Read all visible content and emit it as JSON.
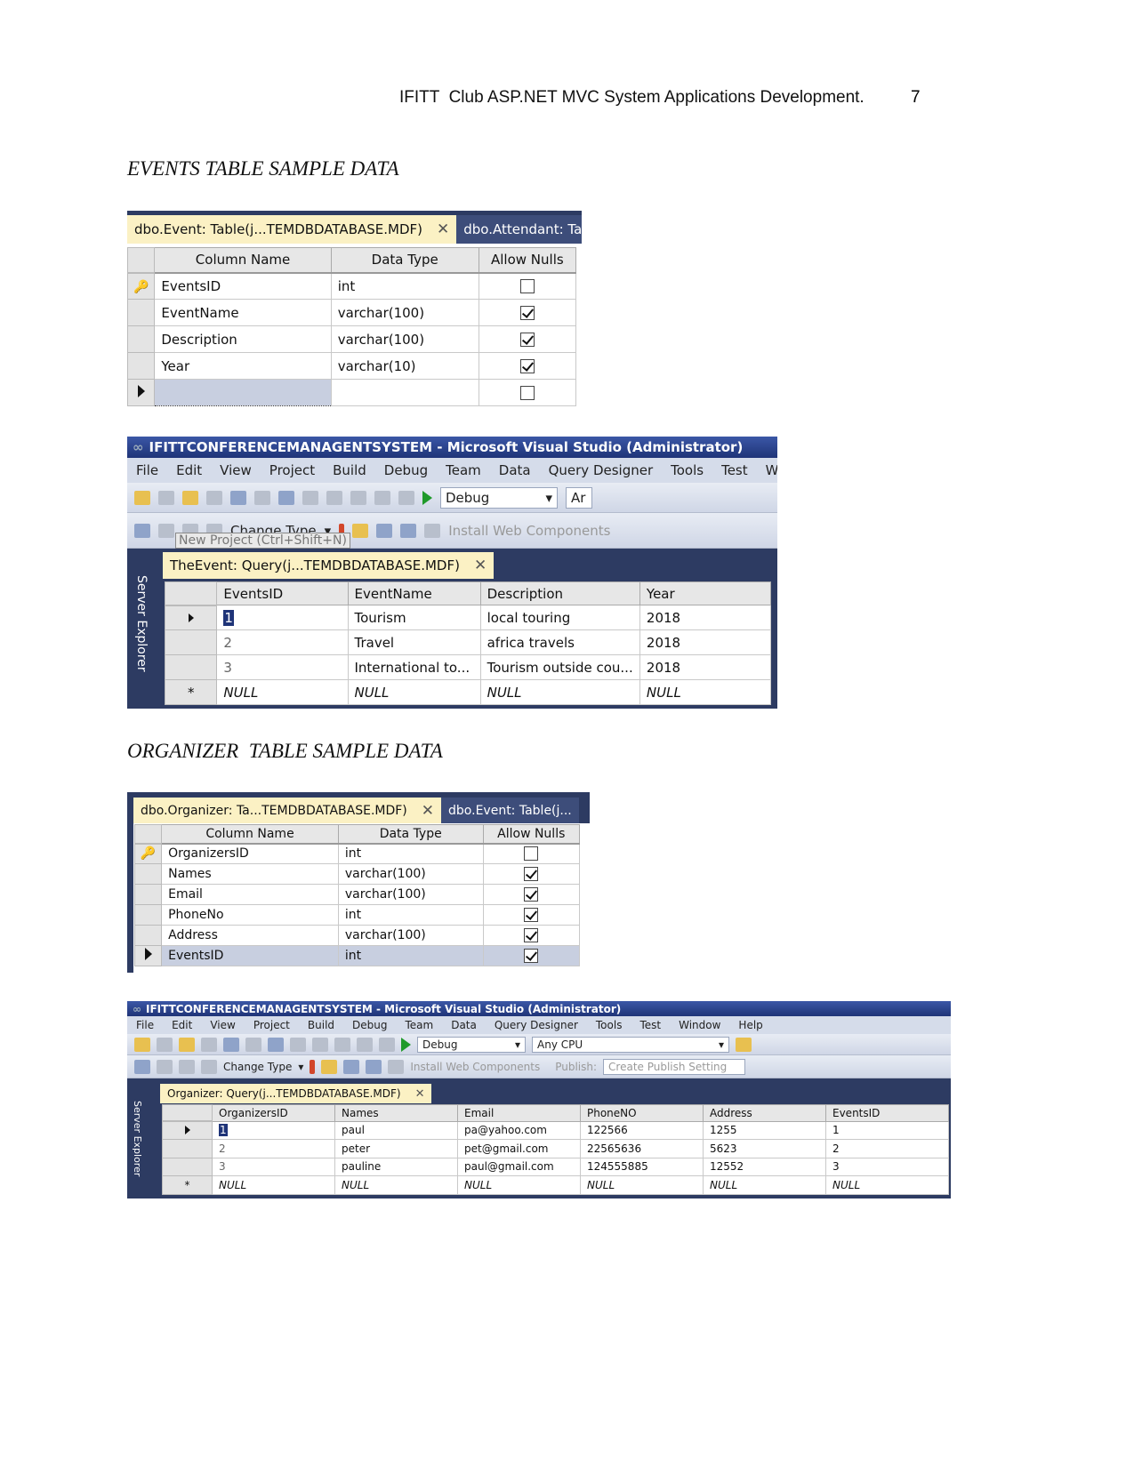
{
  "header": {
    "title": "IFITT  Club ASP.NET MVC System Applications Development.",
    "page_number": "7"
  },
  "sections": [
    {
      "heading": "EVENTS TABLE SAMPLE DATA"
    },
    {
      "heading": "ORGANIZER  TABLE SAMPLE DATA"
    }
  ],
  "event_design": {
    "tabs": [
      "dbo.Event: Table(j...TEMDBDATABASE.MDF)",
      "dbo.Attendant: Ta..."
    ],
    "columns": [
      "Column Name",
      "Data Type",
      "Allow Nulls"
    ],
    "rows": [
      {
        "name": "EventsID",
        "type": "int",
        "nulls": false,
        "key": true
      },
      {
        "name": "EventName",
        "type": "varchar(100)",
        "nulls": true
      },
      {
        "name": "Description",
        "type": "varchar(100)",
        "nulls": true
      },
      {
        "name": "Year",
        "type": "varchar(10)",
        "nulls": true
      },
      {
        "name": "",
        "type": "",
        "nulls": false,
        "current": true
      }
    ]
  },
  "vs1": {
    "title": "IFITTCONFERENCEMANAGENTSYSTEM - Microsoft Visual Studio (Administrator)",
    "menu": [
      "File",
      "Edit",
      "View",
      "Project",
      "Build",
      "Debug",
      "Team",
      "Data",
      "Query Designer",
      "Tools",
      "Test",
      "Win"
    ],
    "config": "Debug",
    "platform": "Ar",
    "change_type": "Change Type",
    "install": "Install Web Components",
    "tooltip": "New Project (Ctrl+Shift+N)",
    "sidebar": "Server Explorer",
    "tab": "TheEvent: Query(j...TEMDBDATABASE.MDF)",
    "columns": [
      "EventsID",
      "EventName",
      "Description",
      "Year"
    ],
    "rows": [
      [
        "1",
        "Tourism",
        "local touring",
        "2018"
      ],
      [
        "2",
        "Travel",
        "africa travels",
        "2018"
      ],
      [
        "3",
        "International to...",
        "Tourism outside cou...",
        "2018"
      ],
      [
        "NULL",
        "NULL",
        "NULL",
        "NULL"
      ]
    ]
  },
  "organizer_design": {
    "tabs": [
      "dbo.Organizer: Ta...TEMDBDATABASE.MDF)",
      "dbo.Event: Table(j..."
    ],
    "columns": [
      "Column Name",
      "Data Type",
      "Allow Nulls"
    ],
    "rows": [
      {
        "name": "OrganizersID",
        "type": "int",
        "nulls": false,
        "key": true
      },
      {
        "name": "Names",
        "type": "varchar(100)",
        "nulls": true
      },
      {
        "name": "Email",
        "type": "varchar(100)",
        "nulls": true
      },
      {
        "name": "PhoneNo",
        "type": "int",
        "nulls": true
      },
      {
        "name": "Address",
        "type": "varchar(100)",
        "nulls": true
      },
      {
        "name": "EventsID",
        "type": "int",
        "nulls": true,
        "current": true
      }
    ]
  },
  "vs2": {
    "title": "IFITTCONFERENCEMANAGENTSYSTEM - Microsoft Visual Studio (Administrator)",
    "menu": [
      "File",
      "Edit",
      "View",
      "Project",
      "Build",
      "Debug",
      "Team",
      "Data",
      "Query Designer",
      "Tools",
      "Test",
      "Window",
      "Help"
    ],
    "config": "Debug",
    "platform": "Any CPU",
    "change_type": "Change Type",
    "install": "Install Web Components",
    "publish_label": "Publish:",
    "publish_value": "Create Publish Setting",
    "sidebar": "Server Explorer",
    "tab": "Organizer: Query(j...TEMDBDATABASE.MDF)",
    "columns": [
      "OrganizersID",
      "Names",
      "Email",
      "PhoneNO",
      "Address",
      "EventsID"
    ],
    "rows": [
      [
        "1",
        "paul",
        "pa@yahoo.com",
        "122566",
        "1255",
        "1"
      ],
      [
        "2",
        "peter",
        "pet@gmail.com",
        "22565636",
        "5623",
        "2"
      ],
      [
        "3",
        "pauline",
        "paul@gmail.com",
        "124555885",
        "12552",
        "3"
      ],
      [
        "NULL",
        "NULL",
        "NULL",
        "NULL",
        "NULL",
        "NULL"
      ]
    ]
  }
}
